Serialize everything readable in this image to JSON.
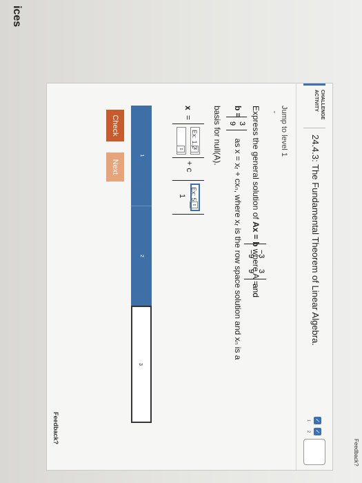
{
  "header": {
    "badge_line1": "CHALLENGE",
    "badge_line2": "ACTIVITY",
    "title": "24.4.3: The Fundamental Theorem of Linear Algebra."
  },
  "levels": [
    {
      "num": "1",
      "status": "done"
    },
    {
      "num": "2",
      "status": "done"
    },
    {
      "num": "3",
      "status": "todo"
    }
  ],
  "jump_label": "Jump to level 1",
  "problem": {
    "prefix": "Express the general solution of ",
    "eq": "Ax = b",
    "where": " where ",
    "A_label": "A =",
    "A_matrix": [
      [
        "−3",
        "3"
      ],
      [
        "−9",
        "9"
      ]
    ],
    "and": "and",
    "b_label": "b =",
    "b_vector": [
      "3",
      "9"
    ],
    "as_text": "as x = xᵣ + cxₙ, where xᵣ is the row space solution and xₙ is a",
    "basis_text": "basis for null(A)."
  },
  "solution": {
    "x_label": "x",
    "equals": "=",
    "select1": "Ex: 1.2",
    "plus_c": "+ c",
    "select2": "Ex: 5",
    "vec2_bottom": "1"
  },
  "steps": [
    "1",
    "2",
    "3"
  ],
  "buttons": {
    "check": "Check",
    "next": "Next"
  },
  "feedback_card": "Feedback?",
  "feedback_top": "Feedback?",
  "edge_text": "ices"
}
